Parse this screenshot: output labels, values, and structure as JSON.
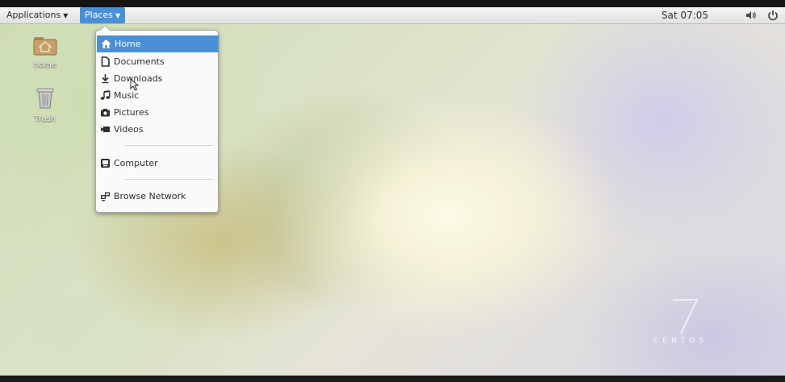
{
  "top_panel": {
    "applications_label": "Applications",
    "places_label": "Places",
    "clock": "Sat 07:05",
    "volume_icon": "volume-icon",
    "power_icon": "power-icon"
  },
  "desktop": {
    "icons": [
      {
        "label": "home",
        "icon": "home-folder-icon"
      },
      {
        "label": "Trash",
        "icon": "trash-icon"
      }
    ],
    "brand": {
      "numeral": "7",
      "wordmark": "CENTOS"
    }
  },
  "places_menu": {
    "items": [
      {
        "label": "Home",
        "icon": "home-icon",
        "selected": true
      },
      {
        "label": "Documents",
        "icon": "document-icon"
      },
      {
        "label": "Downloads",
        "icon": "download-icon"
      },
      {
        "label": "Music",
        "icon": "music-icon"
      },
      {
        "label": "Pictures",
        "icon": "camera-icon"
      },
      {
        "label": "Videos",
        "icon": "video-icon"
      },
      {
        "label": "Computer",
        "icon": "computer-icon"
      },
      {
        "label": "Browse Network",
        "icon": "network-icon"
      }
    ]
  },
  "colors": {
    "accent": "#4a90d9",
    "panel": "#e9e9e9"
  }
}
